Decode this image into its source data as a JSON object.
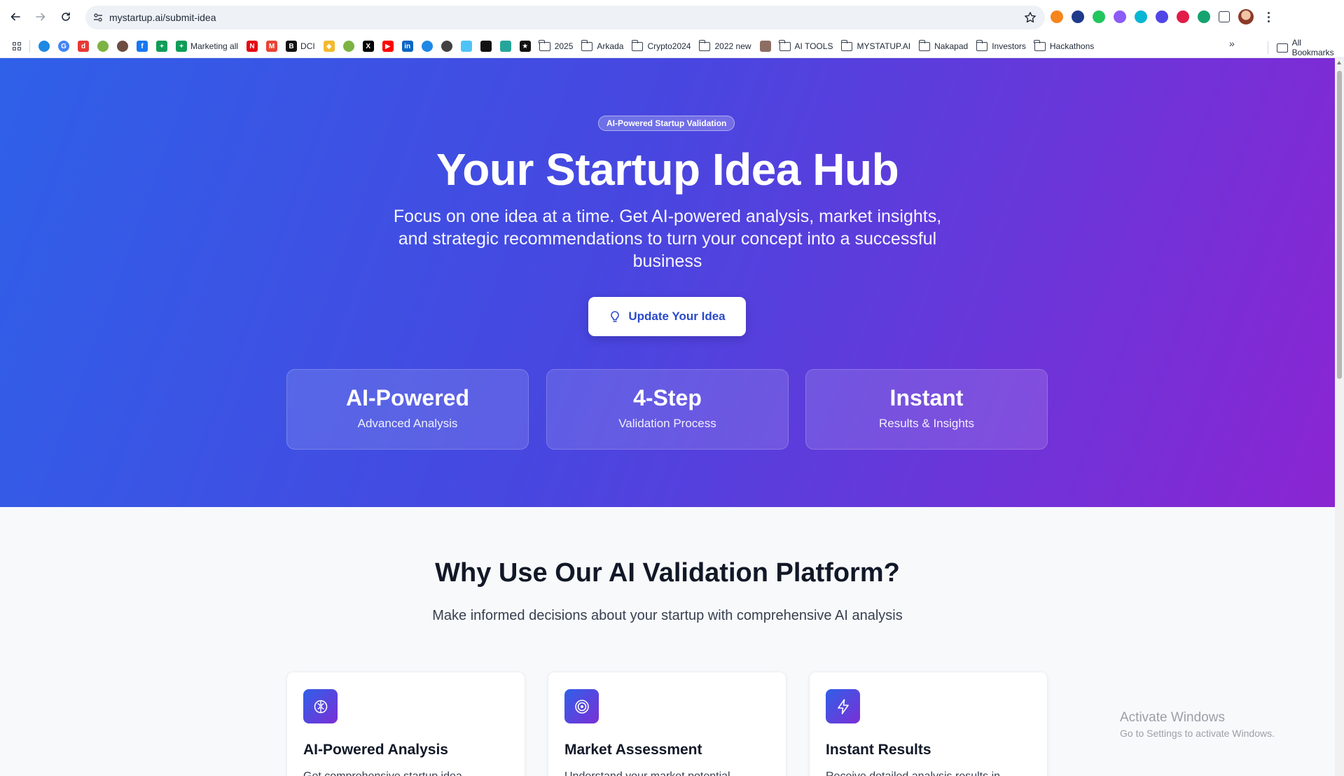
{
  "browser": {
    "url": "mystartup.ai/submit-idea",
    "bookmarks": [
      {
        "type": "icon",
        "icon": "apps-grid-icon",
        "label": ""
      },
      {
        "type": "sep"
      },
      {
        "type": "icon",
        "icon": "drop-icon",
        "color": "#1e88e5",
        "label": ""
      },
      {
        "type": "icon",
        "icon": "google-icon",
        "color": "#4285f4",
        "glyph": "G",
        "label": ""
      },
      {
        "type": "icon",
        "icon": "d-icon",
        "color": "#e53935",
        "glyph": "d",
        "label": ""
      },
      {
        "type": "icon",
        "icon": "frog-icon",
        "color": "#7cb342",
        "label": ""
      },
      {
        "type": "icon",
        "icon": "owl-icon",
        "color": "#6d4c41",
        "label": ""
      },
      {
        "type": "icon",
        "icon": "facebook-icon",
        "color": "#1877f2",
        "glyph": "f",
        "label": ""
      },
      {
        "type": "icon",
        "icon": "sheets-icon",
        "color": "#0f9d58",
        "glyph": "+",
        "label": ""
      },
      {
        "type": "icon",
        "icon": "sheets-icon",
        "color": "#0f9d58",
        "glyph": "+",
        "label": "Marketing all"
      },
      {
        "type": "icon",
        "icon": "netflix-icon",
        "color": "#e50914",
        "glyph": "N",
        "label": ""
      },
      {
        "type": "icon",
        "icon": "gmail-icon",
        "color": "#ea4335",
        "glyph": "M",
        "label": ""
      },
      {
        "type": "icon",
        "icon": "doc-icon",
        "color": "#111111",
        "glyph": "B",
        "label": "DCI"
      },
      {
        "type": "icon",
        "icon": "binance-icon",
        "color": "#f3ba2f",
        "glyph": "◆",
        "label": ""
      },
      {
        "type": "icon",
        "icon": "frog-icon",
        "color": "#7cb342",
        "label": ""
      },
      {
        "type": "icon",
        "icon": "x-icon",
        "color": "#000000",
        "glyph": "X",
        "label": ""
      },
      {
        "type": "icon",
        "icon": "youtube-icon",
        "color": "#ff0000",
        "glyph": "▶",
        "label": ""
      },
      {
        "type": "icon",
        "icon": "linkedin-icon",
        "color": "#0a66c2",
        "glyph": "in",
        "label": ""
      },
      {
        "type": "icon",
        "icon": "blue-circle-icon",
        "color": "#1e88e5",
        "label": ""
      },
      {
        "type": "icon",
        "icon": "globe-icon",
        "color": "#424242",
        "label": ""
      },
      {
        "type": "icon",
        "icon": "chart-icon",
        "color": "#4fc3f7",
        "label": ""
      },
      {
        "type": "icon",
        "icon": "square-icon",
        "color": "#111111",
        "label": ""
      },
      {
        "type": "icon",
        "icon": "wave-icon",
        "color": "#26a69a",
        "label": ""
      },
      {
        "type": "icon",
        "icon": "star-box-icon",
        "color": "#111111",
        "glyph": "★",
        "label": ""
      },
      {
        "type": "folder",
        "label": "2025"
      },
      {
        "type": "folder",
        "label": "Arkada"
      },
      {
        "type": "folder",
        "label": "Crypto2024"
      },
      {
        "type": "folder",
        "label": "2022 new"
      },
      {
        "type": "icon",
        "icon": "wizard-icon",
        "color": "#8d6e63",
        "label": ""
      },
      {
        "type": "folder",
        "label": "AI TOOLS"
      },
      {
        "type": "folder",
        "label": "MYSTATUP.AI"
      },
      {
        "type": "folder",
        "label": "Nakapad"
      },
      {
        "type": "folder",
        "label": "Investors"
      },
      {
        "type": "folder",
        "label": "Hackathons"
      }
    ],
    "more": "»",
    "all_bookmarks": "All Bookmarks",
    "extensions": [
      {
        "icon": "metamask-icon",
        "color": "#f6851b"
      },
      {
        "icon": "cloud-extension-icon",
        "color": "#1e3a8a"
      },
      {
        "icon": "frog-extension-icon",
        "color": "#22c55e"
      },
      {
        "icon": "bird-extension-icon",
        "color": "#8b5cf6"
      },
      {
        "icon": "copy-extension-icon",
        "color": "#06b6d4"
      },
      {
        "icon": "bot-extension-icon",
        "color": "#4f46e5"
      },
      {
        "icon": "block-extension-icon",
        "color": "#e11d48"
      },
      {
        "icon": "grammarly-icon",
        "color": "#15a36f"
      },
      {
        "icon": "puzzle-icon",
        "color": "#374151"
      }
    ]
  },
  "hero": {
    "badge": "AI-Powered Startup Validation",
    "title": "Your Startup Idea Hub",
    "subtitle": "Focus on one idea at a time. Get AI-powered analysis, market insights, and strategic recommendations to turn your concept into a successful business",
    "cta_label": "Update Your Idea",
    "stats": [
      {
        "value": "AI-Powered",
        "label": "Advanced Analysis"
      },
      {
        "value": "4-Step",
        "label": "Validation Process"
      },
      {
        "value": "Instant",
        "label": "Results & Insights"
      }
    ],
    "colors": {
      "start": "#2f60e8",
      "end": "#8a25d2",
      "cta_text": "#2a49c9"
    }
  },
  "why": {
    "title": "Why Use Our AI Validation Platform?",
    "subtitle": "Make informed decisions about your startup with comprehensive AI analysis",
    "features": [
      {
        "icon": "brain-icon",
        "title": "AI-Powered Analysis",
        "desc": "Get comprehensive startup idea"
      },
      {
        "icon": "target-icon",
        "title": "Market Assessment",
        "desc": "Understand your market potential,"
      },
      {
        "icon": "lightning-icon",
        "title": "Instant Results",
        "desc": "Receive detailed analysis results in"
      }
    ]
  },
  "os_watermark": {
    "line1": "Activate Windows",
    "line2": "Go to Settings to activate Windows."
  }
}
